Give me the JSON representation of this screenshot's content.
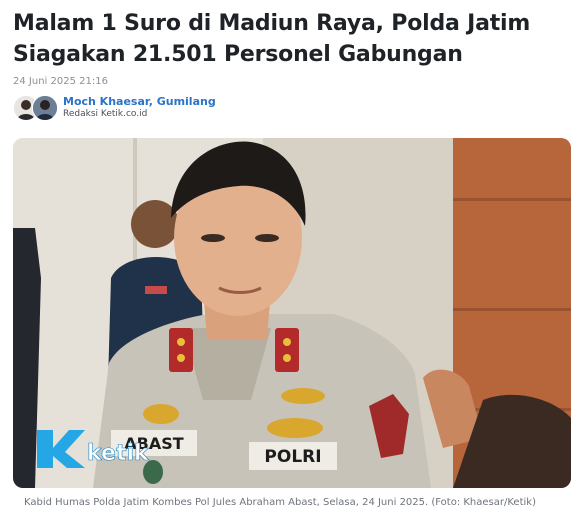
{
  "article": {
    "title": "Malam 1 Suro di Madiun Raya, Polda Jatim Siagakan 21.501 Personel Gabungan",
    "date": "24 Juni 2025 21:16",
    "author_names": "Moch Khaesar, Gumilang",
    "author_org": "Redaksi Ketik.co.id"
  },
  "photo": {
    "watermark_logo_text": "ketik",
    "badge_name_text": "ABAST",
    "badge_polri_text": "POLRI"
  },
  "caption": "Kabid Humas Polda Jatim Kombes Pol Jules Abraham Abast, Selasa, 24 Juni 2025. (Foto: Khaesar/Ketik)",
  "colors": {
    "author_link": "#2a73c7",
    "title": "#1f2328",
    "logo": "#25a7e6"
  }
}
